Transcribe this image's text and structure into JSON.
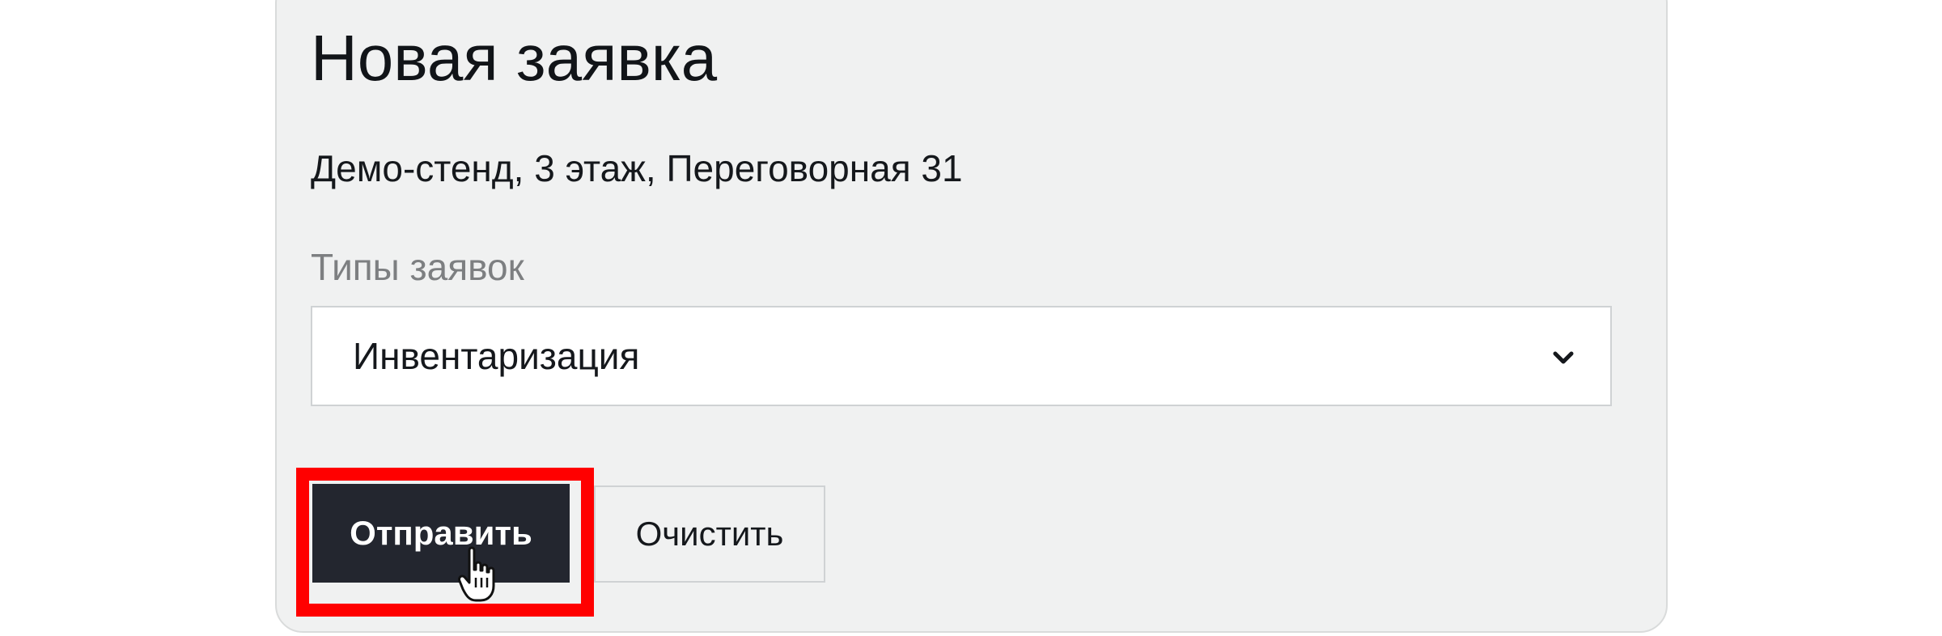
{
  "form": {
    "title": "Новая заявка",
    "location": "Демо-стенд, 3 этаж, Переговорная 31",
    "request_type_label": "Типы заявок",
    "request_type_selected": "Инвентаризация",
    "submit_label": "Отправить",
    "clear_label": "Очистить"
  },
  "icons": {
    "select_arrow": "chevron-down-icon",
    "pointer": "hand-pointer-cursor-icon"
  },
  "colors": {
    "card_background": "#f0f1f1",
    "primary_button": "#23262f",
    "highlight": "#ff0000",
    "label_muted": "#7d7f81"
  }
}
